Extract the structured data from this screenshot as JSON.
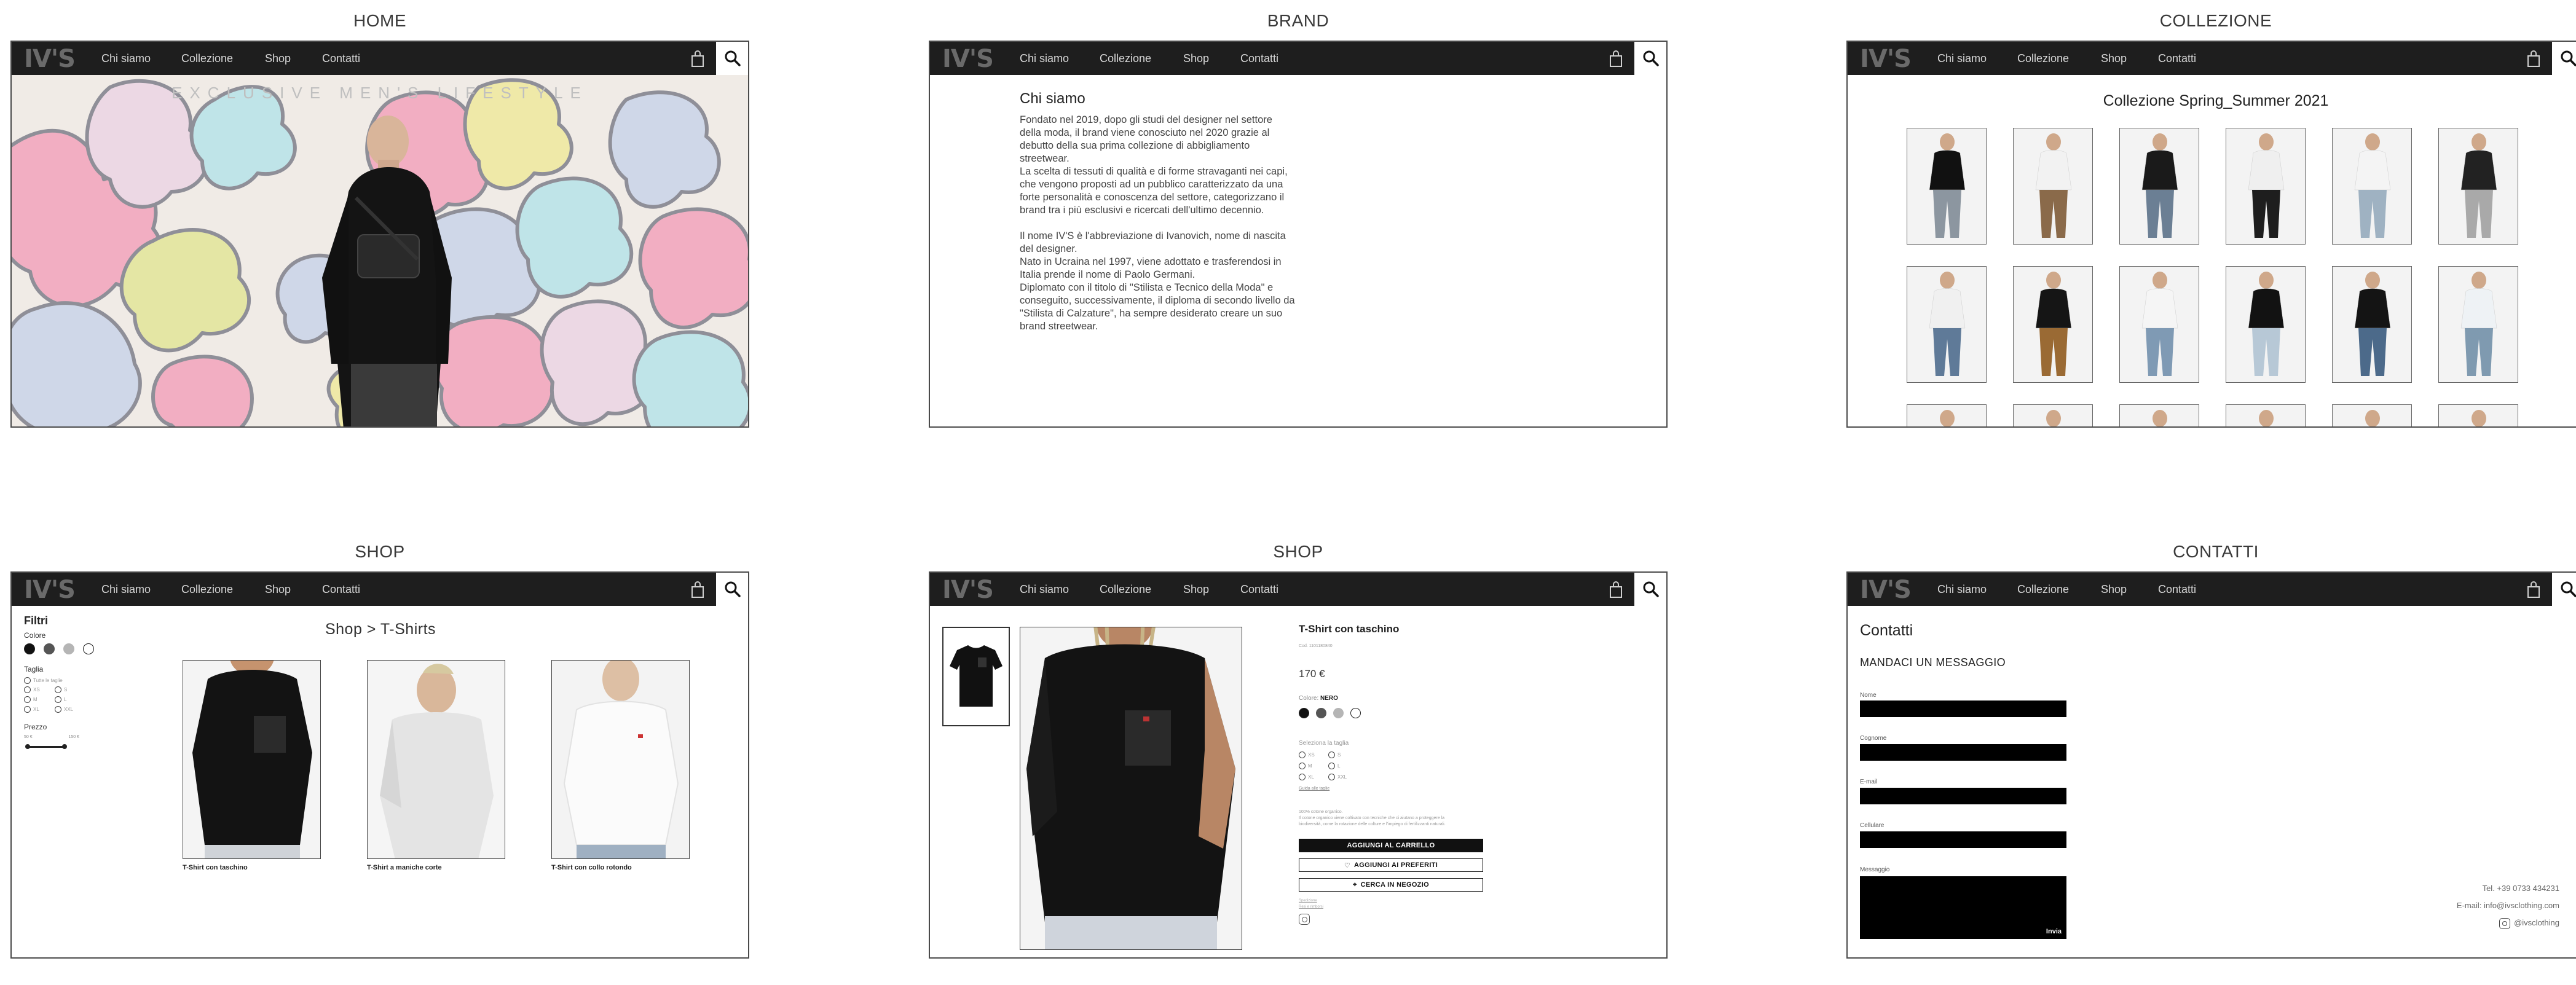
{
  "nav": {
    "logo": "IV'S",
    "items": [
      "Chi siamo",
      "Collezione",
      "Shop",
      "Contatti"
    ]
  },
  "boards": {
    "home": "HOME",
    "brand": "BRAND",
    "collezione": "COLLEZIONE",
    "shop_list": "SHOP",
    "shop_detail": "SHOP",
    "contatti": "CONTATTI"
  },
  "home": {
    "tagline": "EXCLUSIVE MEN'S LIFESTYLE"
  },
  "brand": {
    "title": "Chi siamo",
    "paragraphs": [
      "Fondato nel 2019, dopo gli studi del designer nel settore della moda, il brand viene conosciuto nel 2020 grazie al debutto della sua prima collezione di abbigliamento streetwear.\nLa scelta di tessuti di qualità e di forme stravaganti nei capi, che vengono proposti ad un pubblico caratterizzato da una forte personalità e conoscenza del settore, categorizzano il brand tra i più esclusivi e ricercati dell'ultimo decennio.",
      "Il nome IV'S è l'abbreviazione di Ivanovich, nome di nascita del designer.\nNato in Ucraina nel 1997, viene adottato e trasferendosi in Italia prende il nome di Paolo Germani.\nDiplomato con il titolo di \"Stilista e Tecnico della Moda\" e conseguito, successivamente, il diploma di secondo livello da \"Stilista di Calzature\", ha sempre desiderato creare un suo brand streetwear."
    ]
  },
  "collezione": {
    "title": "Collezione Spring_Summer 2021",
    "items": [
      {
        "top": "#111111",
        "bottom": "#8c96a0"
      },
      {
        "top": "#f2f2f2",
        "bottom": "#8a6a4a"
      },
      {
        "top": "#1a1a1a",
        "bottom": "#6b7f94"
      },
      {
        "top": "#efefef",
        "bottom": "#1e1e1e"
      },
      {
        "top": "#f4f4f4",
        "bottom": "#9fb2c2"
      },
      {
        "top": "#222222",
        "bottom": "#a9a9a9"
      },
      {
        "top": "#f0f0f0",
        "bottom": "#5f7a98"
      },
      {
        "top": "#151515",
        "bottom": "#9a6a34"
      },
      {
        "top": "#f5f5f5",
        "bottom": "#7f9ab4"
      },
      {
        "top": "#121212",
        "bottom": "#b7c8d6"
      },
      {
        "top": "#141414",
        "bottom": "#4c6a8a"
      },
      {
        "top": "#eef2f5",
        "bottom": "#7f9ab0"
      },
      {
        "top": "#5f7894",
        "bottom": "#ffffff"
      },
      {
        "top": "#111111",
        "bottom": "#ffffff"
      },
      {
        "top": "#1a1a1a",
        "bottom": "#ffffff"
      },
      {
        "top": "#101010",
        "bottom": "#ffffff"
      },
      {
        "top": "#1c1c1c",
        "bottom": "#ffffff"
      },
      {
        "top": "#c4a982",
        "bottom": "#ffffff"
      }
    ]
  },
  "shop_list": {
    "title": "Shop  >  T-Shirts",
    "filters": {
      "title": "Filtri",
      "color_label": "Colore",
      "colors": [
        "#111111",
        "#555555",
        "#b5b5b5",
        "#ffffff"
      ],
      "size_label": "Taglia",
      "sizes": [
        "Tutte le taglie",
        "XS",
        "S",
        "M",
        "L",
        "XL",
        "XXL"
      ],
      "price_label": "Prezzo",
      "price_min": "50 €",
      "price_max": "150 €"
    },
    "products": [
      {
        "name": "T-Shirt con taschino",
        "color": "#111111"
      },
      {
        "name": "T-Shirt a maniche corte",
        "color": "#e6e6e6"
      },
      {
        "name": "T-Shirt con collo rotondo",
        "color": "#fafafa"
      }
    ]
  },
  "shop_detail": {
    "name": "T-Shirt con taschino",
    "ref": "Cod. 1101180840",
    "price": "170 €",
    "color_label": "Colore:",
    "color_value": "NERO",
    "colors": [
      "#111111",
      "#555555",
      "#b5b5b5",
      "#ffffff"
    ],
    "size_label": "Seleziona la taglia",
    "sizes": [
      "XS",
      "S",
      "M",
      "L",
      "XL",
      "XXL"
    ],
    "guide": "Guida alle taglie",
    "description": "100% cotone organico.\nIl cotone organico viene coltivato con tecniche che ci aiutano a proteggere la\nbiodiversità, come la rotazione delle colture e l'impiego di fertilizzanti naturali.",
    "btn_cart": "AGGIUNGI AL CARRELLO",
    "btn_fav": "AGGIUNGI AI PREFERITI",
    "btn_store": "CERCA IN NEGOZIO",
    "link1": "Spedizione",
    "link2": "Resi e rimborsi"
  },
  "contatti": {
    "title": "Contatti",
    "subtitle": "MANDACI UN MESSAGGIO",
    "fields": [
      "Nome",
      "Cognome",
      "E-mail",
      "Cellulare"
    ],
    "message_label": "Messaggio",
    "send": "Invia",
    "phone": "Tel. +39 0733 434231",
    "email": "E-mail: info@ivsclothing.com",
    "instagram": "@ivsclothing"
  }
}
